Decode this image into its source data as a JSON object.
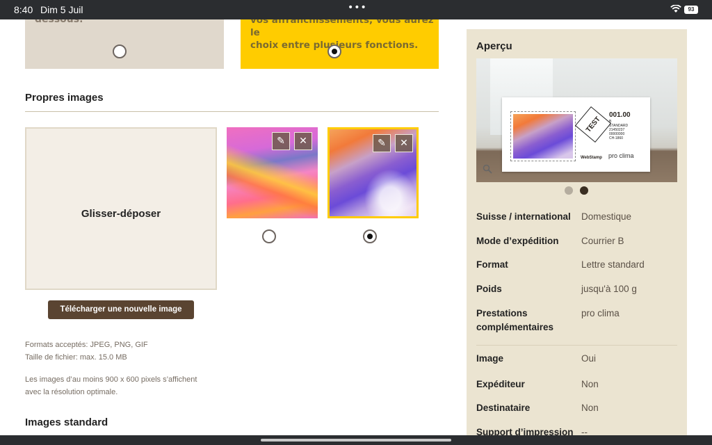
{
  "status_bar": {
    "time": "8:40",
    "date": "Dim 5 Juil",
    "more": "•••",
    "battery": "93"
  },
  "options": {
    "card1_text": "dessous.",
    "card2_text_line1": "vos affranchissements, vous aurez le",
    "card2_text_line2": "choix entre plusieurs fonctions."
  },
  "own_images": {
    "title": "Propres images",
    "dropzone_label": "Glisser-déposer",
    "upload_button": "Télécharger une nouvelle image",
    "formats_line1": "Formats acceptés: JPEG, PNG, GIF",
    "formats_line2": "Taille de fichier: max. 15.0 MB",
    "resolution_line1": "Les images d’au moins 900 x 600 pixels s’affichent",
    "resolution_line2": "avec la résolution optimale.",
    "edit_icon": "✎",
    "delete_icon": "✕"
  },
  "standard_images": {
    "title": "Images standard"
  },
  "preview": {
    "title": "Aperçu",
    "stamp_test": "TEST",
    "stamp_value": "001.00",
    "stamp_lines": [
      "B",
      "STANDARD",
      "21450237",
      "00000000",
      "CH-1860"
    ],
    "webstamp": "WebStamp",
    "proclima": "pro clima"
  },
  "summary": {
    "rows": [
      {
        "label": "Suisse / international",
        "value": "Domestique"
      },
      {
        "label": "Mode d’expédition",
        "value": "Courrier B"
      },
      {
        "label": "Format",
        "value": "Lettre standard"
      },
      {
        "label": "Poids",
        "value": "jusqu'à 100 g"
      },
      {
        "label": "Prestations complémentaires",
        "value": "pro clima"
      },
      {
        "label": "Image",
        "value": "Oui"
      },
      {
        "label": "Expéditeur",
        "value": "Non"
      },
      {
        "label": "Destinataire",
        "value": "Non"
      },
      {
        "label": "Support d’impression",
        "value": "--"
      }
    ]
  },
  "colors": {
    "accent_yellow": "#ffcc00",
    "brown_button": "#5a4431",
    "panel_bg": "#ebe4d1"
  }
}
